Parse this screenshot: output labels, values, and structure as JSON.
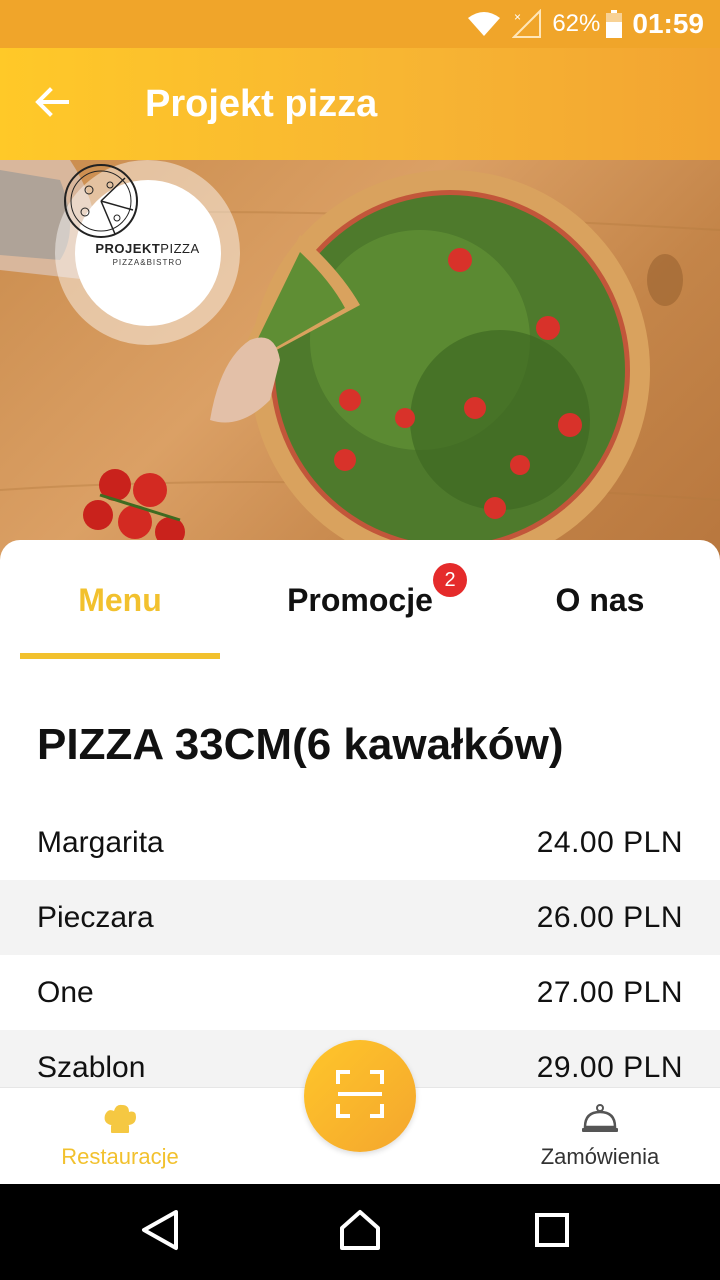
{
  "status_bar": {
    "battery_percent": "62%",
    "time": "01:59",
    "icons": [
      "wifi-icon",
      "no-signal-icon",
      "battery-icon"
    ]
  },
  "app_bar": {
    "title": "Projekt pizza",
    "back_icon": "arrow-left-icon"
  },
  "restaurant_logo": {
    "name_bold": "PROJEKT",
    "name_light": "PIZZA",
    "tagline": "PIZZA&BISTRO"
  },
  "tabs": [
    {
      "label": "Menu",
      "active": true
    },
    {
      "label": "Promocje",
      "active": false,
      "badge": "2"
    },
    {
      "label": "O nas",
      "active": false
    }
  ],
  "menu": {
    "section_title": "PIZZA 33CM(6 kawałków)",
    "items": [
      {
        "name": "Margarita",
        "price": "24.00 PLN"
      },
      {
        "name": "Pieczara",
        "price": "26.00 PLN"
      },
      {
        "name": "One",
        "price": "27.00 PLN"
      },
      {
        "name": "Szablon",
        "price": "29.00 PLN"
      }
    ]
  },
  "bottom_nav": {
    "left_label": "Restauracje",
    "left_icon": "chef-hat-icon",
    "center_icon": "qr-scan-icon",
    "right_label": "Zamówienia",
    "right_icon": "cloche-icon"
  },
  "system_nav": {
    "icons": [
      "back-triangle-icon",
      "home-icon",
      "recents-icon"
    ]
  },
  "colors": {
    "accent": "#f2c12e",
    "app_bar": "#f7b433",
    "status_bar": "#f0a52a",
    "badge": "#e52b2b",
    "inactive_text": "#111111"
  }
}
